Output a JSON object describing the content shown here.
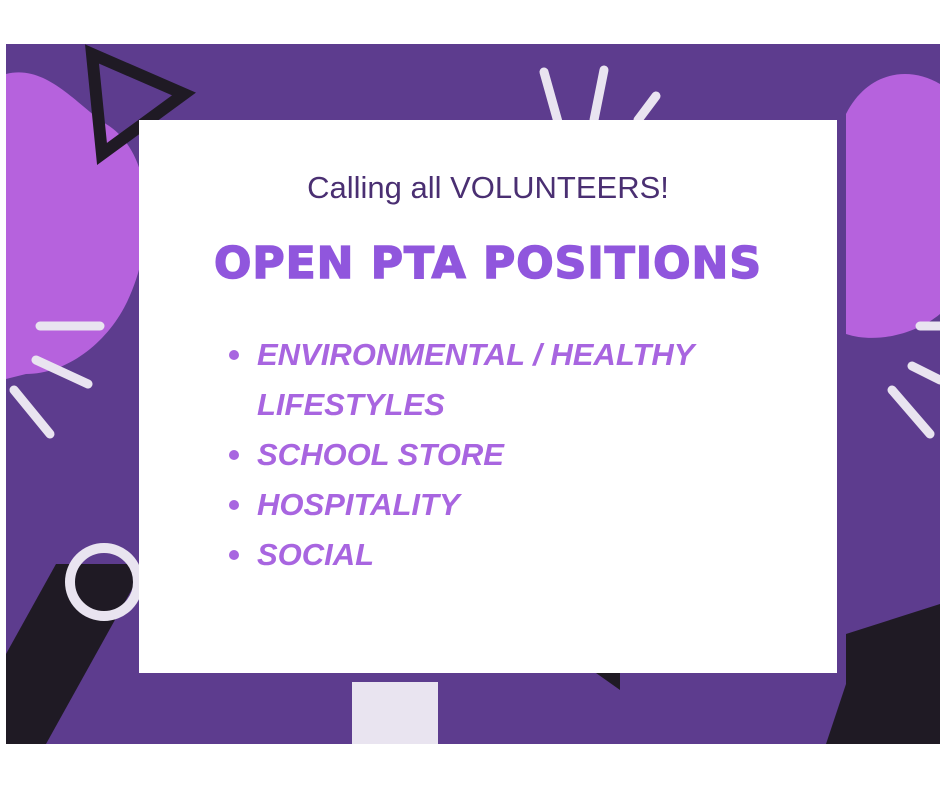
{
  "flyer": {
    "subtitle": "Calling all VOLUNTEERS!",
    "title": "OPEN PTA POSITIONS",
    "positions": [
      {
        "label": "ENVIRONMENTAL / HEALTHY\nLIFESTYLES"
      },
      {
        "label": "SCHOOL STORE"
      },
      {
        "label": "HOSPITALITY"
      },
      {
        "label": "SOCIAL"
      }
    ]
  },
  "colors": {
    "background_purple": "#5d3c8e",
    "lilac_blob": "#b662dd",
    "dark_shape": "#1f1a24",
    "title_purple": "#9056dd",
    "list_purple": "#a865e0",
    "subtitle_purple": "#4a2f72"
  }
}
